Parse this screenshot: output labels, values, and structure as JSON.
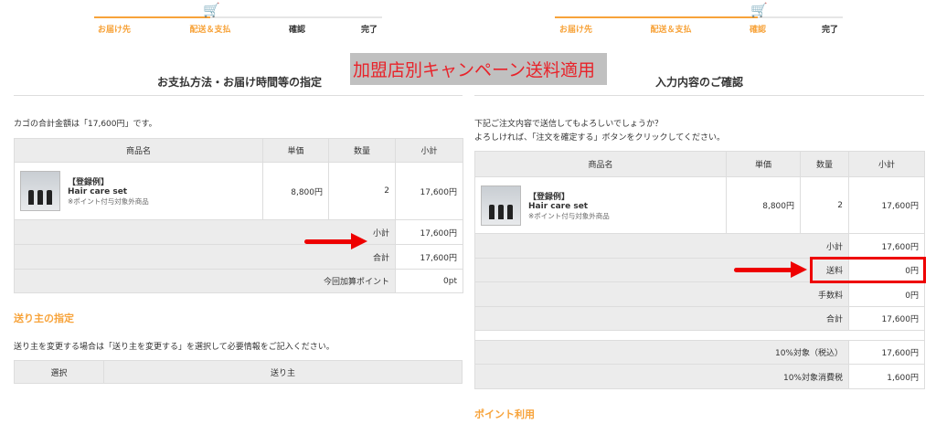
{
  "steps": [
    "お届け先",
    "配送＆支払",
    "確認",
    "完了"
  ],
  "banner": "加盟店別キャンペーン送料適用",
  "left": {
    "title": "お支払方法・お届け時間等の指定",
    "intro": "カゴの合計金額は「17,600円」です。",
    "headers": [
      "商品名",
      "単価",
      "数量",
      "小計"
    ],
    "product": {
      "tag": "【登録例】",
      "name": "Hair care set",
      "note": "※ポイント付与対象外商品",
      "price": "8,800円",
      "qty": "2",
      "subtotal": "17,600円"
    },
    "summary": [
      {
        "label": "小計",
        "value": "17,600円"
      },
      {
        "label": "合計",
        "value": "17,600円"
      },
      {
        "label": "今回加算ポイント",
        "value": "0pt"
      }
    ],
    "sender_heading": "送り主の指定",
    "sender_text": "送り主を変更する場合は「送り主を変更する」を選択して必要情報をご記入ください。",
    "sender_headers": [
      "選択",
      "送り主"
    ]
  },
  "right": {
    "title": "入力内容のご確認",
    "intro1": "下記ご注文内容で送信してもよろしいでしょうか？",
    "intro2": "よろしければ、「注文を確定する」ボタンをクリックしてください。",
    "headers": [
      "商品名",
      "単価",
      "数量",
      "小計"
    ],
    "product": {
      "tag": "【登録例】",
      "name": "Hair care set",
      "note": "※ポイント付与対象外商品",
      "price": "8,800円",
      "qty": "2",
      "subtotal": "17,600円"
    },
    "summary": [
      {
        "label": "小計",
        "value": "17,600円"
      },
      {
        "label": "送料",
        "value": "0円"
      },
      {
        "label": "手数料",
        "value": "0円"
      },
      {
        "label": "合計",
        "value": "17,600円"
      }
    ],
    "tax": [
      {
        "label": "10%対象（税込）",
        "value": "17,600円"
      },
      {
        "label": "10%対象消費税",
        "value": "1,600円"
      }
    ],
    "points_heading": "ポイント利用"
  },
  "colors": {
    "accent": "#f7a33a",
    "highlight": "#e00000"
  }
}
